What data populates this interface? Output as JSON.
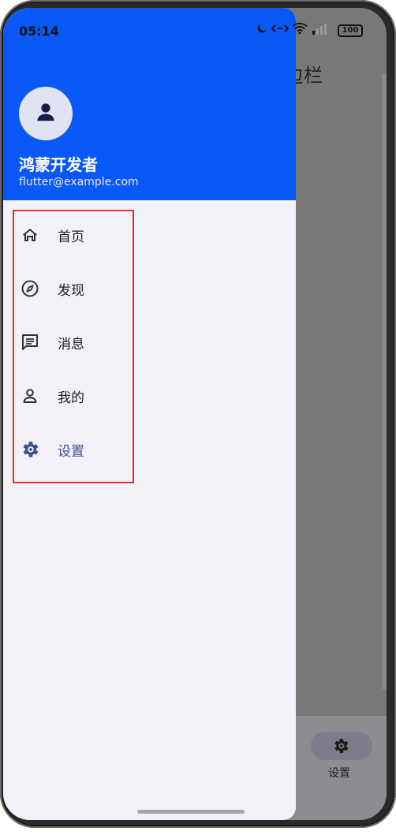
{
  "status_bar": {
    "time": "05:14",
    "battery": "100"
  },
  "background_app": {
    "title": "边栏",
    "bottom_nav": {
      "settings_label": "设置"
    }
  },
  "drawer": {
    "header": {
      "user_name": "鸿蒙开发者",
      "user_email": "flutter@example.com"
    },
    "menu": [
      {
        "label": "首页",
        "icon": "home-icon"
      },
      {
        "label": "发现",
        "icon": "compass-icon"
      },
      {
        "label": "消息",
        "icon": "message-icon"
      },
      {
        "label": "我的",
        "icon": "person-icon"
      },
      {
        "label": "设置",
        "icon": "gear-icon"
      }
    ],
    "active_index": 4
  },
  "colors": {
    "header_blue": "#0a58f5",
    "drawer_bg": "#f3f1f8",
    "active_item": "#3c4f8f",
    "highlight_red": "#e0302f"
  }
}
